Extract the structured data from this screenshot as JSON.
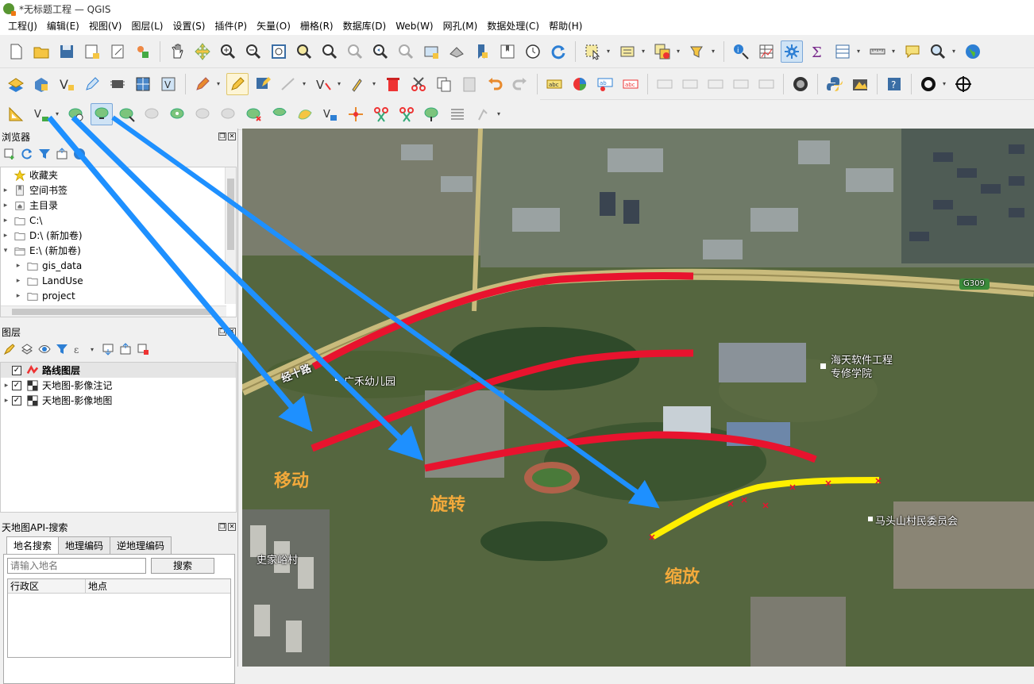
{
  "window": {
    "title": "*无标题工程 — QGIS"
  },
  "menu": [
    "工程(J)",
    "编辑(E)",
    "视图(V)",
    "图层(L)",
    "设置(S)",
    "插件(P)",
    "矢量(O)",
    "栅格(R)",
    "数据库(D)",
    "Web(W)",
    "网孔(M)",
    "数据处理(C)",
    "帮助(H)"
  ],
  "browser_panel": {
    "title": "浏览器",
    "items": [
      {
        "label": "收藏夹",
        "icon": "star-icon"
      },
      {
        "label": "空间书签",
        "icon": "bookmark-icon"
      },
      {
        "label": "主目录",
        "icon": "home-folder-icon"
      },
      {
        "label": "C:\\",
        "icon": "folder-icon"
      },
      {
        "label": "D:\\ (新加卷)",
        "icon": "folder-icon"
      },
      {
        "label": "E:\\ (新加卷)",
        "icon": "folder-open-icon"
      },
      {
        "label": "gis_data",
        "icon": "folder-icon"
      },
      {
        "label": "LandUse",
        "icon": "folder-icon"
      },
      {
        "label": "project",
        "icon": "folder-icon"
      }
    ]
  },
  "layers_panel": {
    "title": "图层",
    "layers": [
      {
        "name": "路线图层",
        "checked": true,
        "bold": true
      },
      {
        "name": "天地图-影像注记",
        "checked": true
      },
      {
        "name": "天地图-影像地图",
        "checked": true
      }
    ]
  },
  "search_panel": {
    "title": "天地图API-搜索",
    "tabs": [
      "地名搜索",
      "地理编码",
      "逆地理编码"
    ],
    "input_placeholder": "请输入地名",
    "search_button": "搜索",
    "columns": [
      "行政区",
      "地点"
    ]
  },
  "map": {
    "labels": {
      "road_g309": "G309",
      "road_jing10": "经十路",
      "kindergarten": "广禾幼儿园",
      "school": "海天软件工程\n专修学院",
      "village_committee": "马头山村民委员会",
      "village": "史家峪村"
    },
    "annotations": {
      "move": "移动",
      "rotate": "旋转",
      "scale": "缩放"
    },
    "colors": {
      "route": "#e8132e",
      "selected_route": "#ffef00",
      "arrow": "#1e90ff",
      "annotation": "#f2a93b"
    }
  }
}
